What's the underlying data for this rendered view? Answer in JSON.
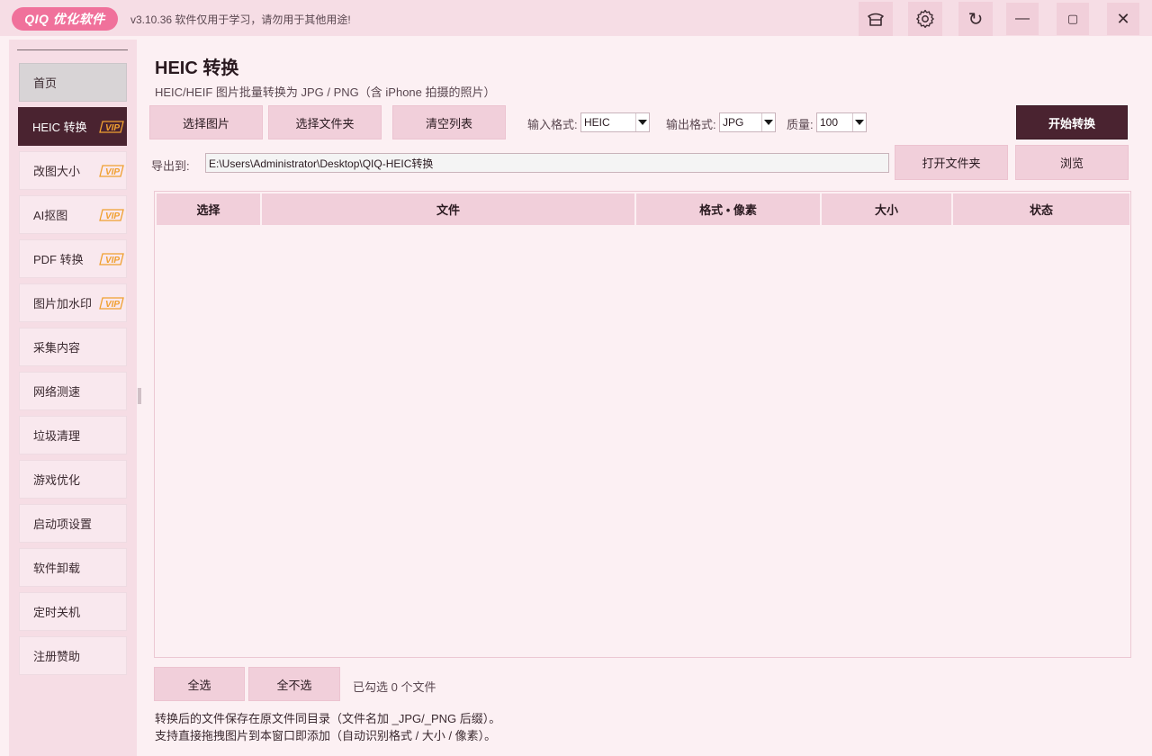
{
  "app": {
    "logo": "QIQ 优化软件",
    "version_notice": "v3.10.36  软件仅用于学习，请勿用于其他用途!"
  },
  "titlebar_buttons": {
    "skin_icon": "hat-icon",
    "settings_icon": "gear-icon",
    "refresh_glyph": "↻",
    "minimize_glyph": "—",
    "maximize_glyph": "▢",
    "close_glyph": "✕"
  },
  "sidebar": {
    "items": [
      {
        "label": "首页",
        "vip": false
      },
      {
        "label": "HEIC 转换",
        "vip": true
      },
      {
        "label": "改图大小",
        "vip": true
      },
      {
        "label": "AI抠图",
        "vip": true
      },
      {
        "label": "PDF 转换",
        "vip": true
      },
      {
        "label": "图片加水印",
        "vip": true
      },
      {
        "label": "采集内容",
        "vip": false
      },
      {
        "label": "网络测速",
        "vip": false
      },
      {
        "label": "垃圾清理",
        "vip": false
      },
      {
        "label": "游戏优化",
        "vip": false
      },
      {
        "label": "启动项设置",
        "vip": false
      },
      {
        "label": "软件卸载",
        "vip": false
      },
      {
        "label": "定时关机",
        "vip": false
      },
      {
        "label": "注册赞助",
        "vip": false
      }
    ],
    "vip_badge": "VIP",
    "active_index": 1
  },
  "main": {
    "title": "HEIC 转换",
    "subtitle": "HEIC/HEIF 图片批量转换为 JPG / PNG（含 iPhone 拍摄的照片）",
    "toolbar": {
      "select_images": "选择图片",
      "select_folder": "选择文件夹",
      "clear_list": "清空列表",
      "input_format_label": "输入格式:",
      "input_format_value": "HEIC",
      "output_format_label": "输出格式:",
      "output_format_value": "JPG",
      "quality_label": "质量:",
      "quality_value": "100",
      "start": "开始转换"
    },
    "export": {
      "label": "导出到:",
      "path": "E:\\Users\\Administrator\\Desktop\\QIQ-HEIC转换",
      "open_folder": "打开文件夹",
      "browse": "浏览"
    },
    "table": {
      "columns": [
        "选择",
        "文件",
        "格式 • 像素",
        "大小",
        "状态"
      ],
      "rows": []
    },
    "footer": {
      "select_all": "全选",
      "select_none": "全不选",
      "selected_status": "已勾选 0 个文件",
      "note1": "转换后的文件保存在原文件同目录（文件名加 _JPG/_PNG 后缀）。",
      "note2": "支持直接拖拽图片到本窗口即添加（自动识别格式 / 大小 / 像素）。"
    }
  },
  "colors": {
    "accent": "#4a2330",
    "button": "#f1cfda",
    "background": "#fcf0f3",
    "logo": "#f0719b",
    "vip": "#f0a030"
  }
}
